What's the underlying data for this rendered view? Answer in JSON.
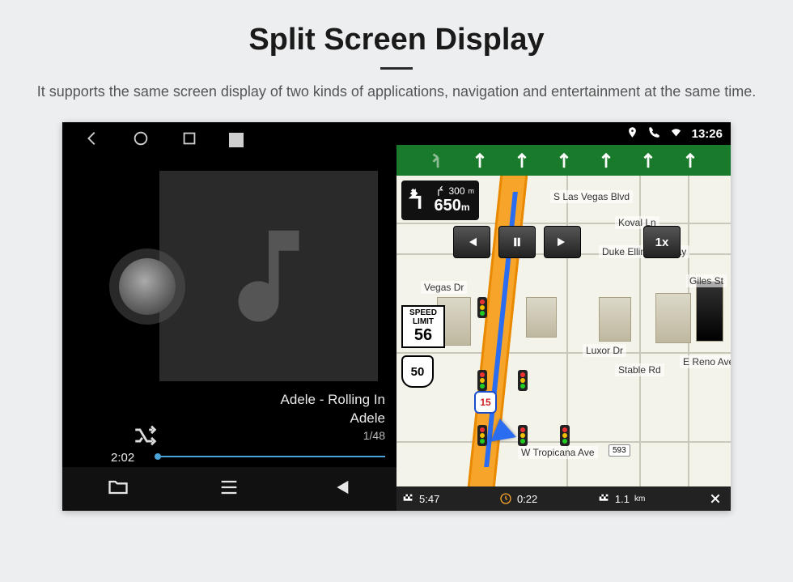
{
  "page": {
    "title": "Split Screen Display",
    "subtitle": "It supports the same screen display of two kinds of applications, navigation and entertainment at the same time."
  },
  "status_bar": {
    "time": "13:26"
  },
  "music": {
    "track_title": "Adele - Rolling In",
    "artist": "Adele",
    "track_index": "1/48",
    "elapsed": "2:02"
  },
  "nav": {
    "turn": {
      "main_dist": "650",
      "main_unit": "m",
      "next_dist": "300",
      "next_unit": "m"
    },
    "speed_limit_label": "SPEED LIMIT",
    "speed_limit_value": "56",
    "route_shield": "50",
    "interstate": "15",
    "playback_speed": "1x",
    "streets": {
      "s_las_vegas": "S Las Vegas Blvd",
      "koval": "Koval Ln",
      "duke": "Duke Ellington Way",
      "vegas_dr": "Vegas Dr",
      "luxor": "Luxor Dr",
      "stable": "Stable Rd",
      "reno": "E Reno Ave",
      "tropicana": "W Tropicana Ave",
      "giles": "Giles St"
    },
    "addr_pill": "593",
    "bottom": {
      "eta": "5:47",
      "time_rem": "0:22",
      "dist_rem": "1.1",
      "dist_unit": "km"
    }
  }
}
